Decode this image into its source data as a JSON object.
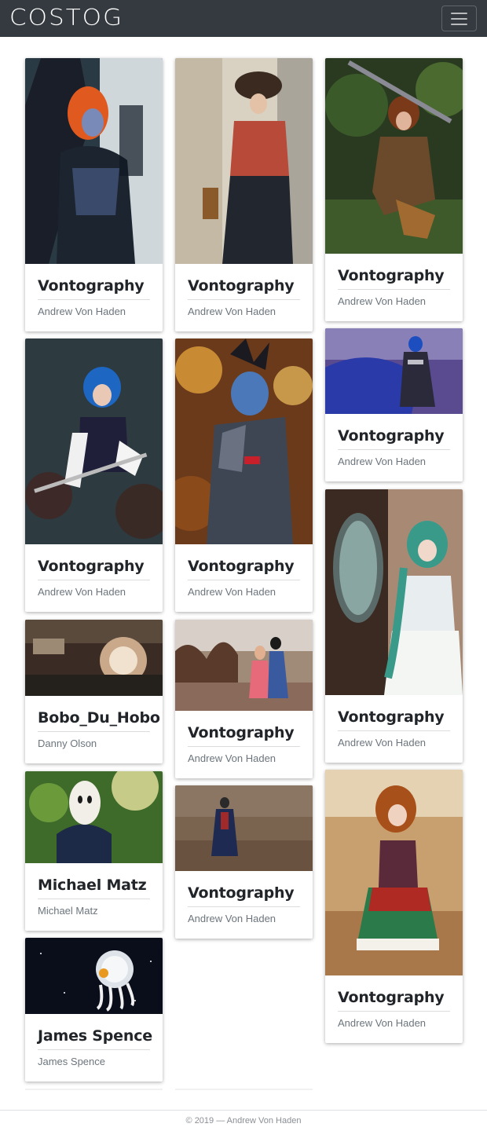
{
  "brand": "COSTOG",
  "cards": [
    {
      "title": "Vontography",
      "author": "Andrew Von Haden"
    },
    {
      "title": "Vontography",
      "author": "Andrew Von Haden"
    },
    {
      "title": "Vontography",
      "author": "Andrew Von Haden"
    },
    {
      "title": "Vontography",
      "author": "Andrew Von Haden"
    },
    {
      "title": "Vontography",
      "author": "Andrew Von Haden"
    },
    {
      "title": "Vontography",
      "author": "Andrew Von Haden"
    },
    {
      "title": "Vontography",
      "author": "Andrew Von Haden"
    },
    {
      "title": "Bobo_Du_Hobo",
      "author": "Danny Olson"
    },
    {
      "title": "Vontography",
      "author": "Andrew Von Haden"
    },
    {
      "title": "Michael Matz",
      "author": "Michael Matz"
    },
    {
      "title": "Vontography",
      "author": "Andrew Von Haden"
    },
    {
      "title": "Vontography",
      "author": "Andrew Von Haden"
    },
    {
      "title": "James Spence",
      "author": "James Spence"
    }
  ],
  "footer": "© 2019 — Andrew Von Haden",
  "colors": {
    "navbar": "#343a40",
    "text": "#212529",
    "muted": "#6c757d"
  }
}
